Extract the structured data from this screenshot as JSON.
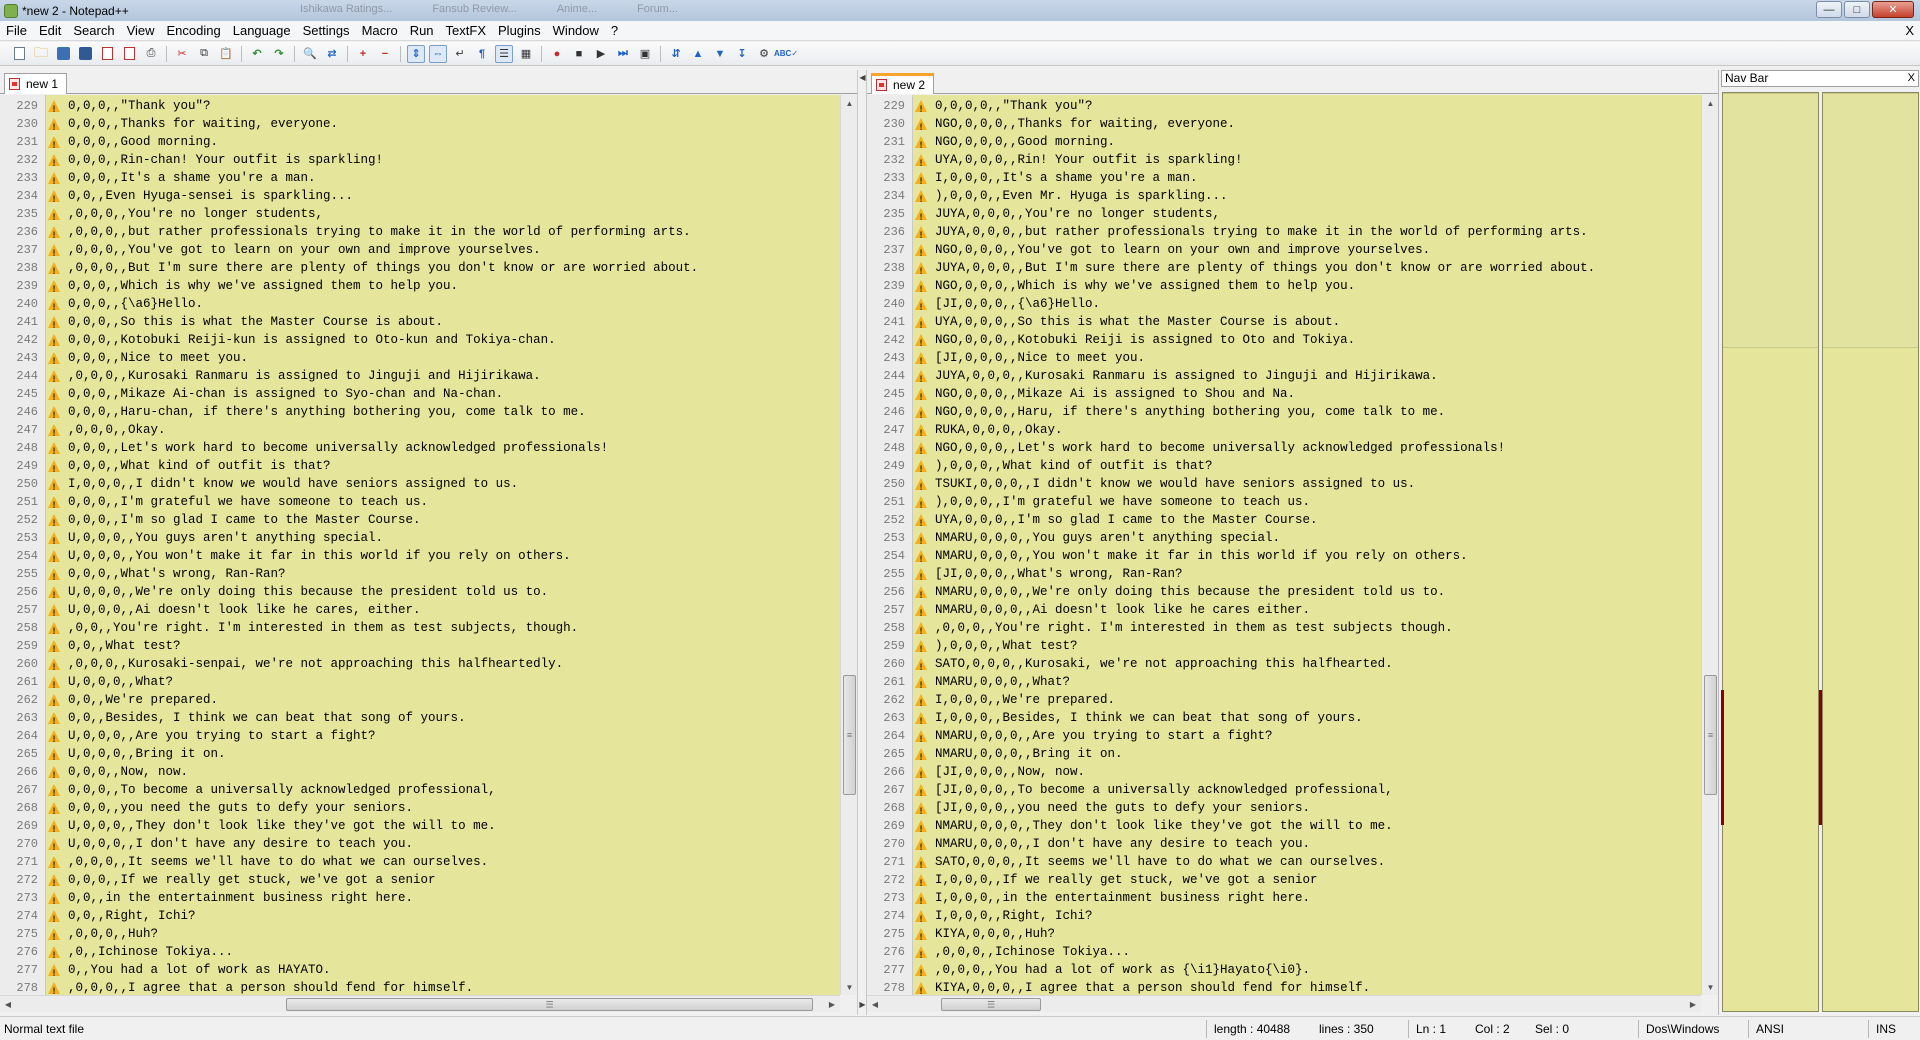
{
  "window": {
    "title": "*new  2 - Notepad++",
    "background_tabs": [
      "Ishikawa Ratings...",
      "Fansub Review...",
      "Anime...",
      "Forum..."
    ]
  },
  "menu": [
    "File",
    "Edit",
    "Search",
    "View",
    "Encoding",
    "Language",
    "Settings",
    "Macro",
    "Run",
    "TextFX",
    "Plugins",
    "Window",
    "?"
  ],
  "menu_close": "X",
  "tabs": {
    "left": "new  1",
    "right": "new  2"
  },
  "nav_bar": {
    "title": "Nav Bar",
    "close": "X"
  },
  "colors": {
    "editor_bg": "#e5e59b",
    "highlight": "#d2d28a",
    "warning": "#f2b01e",
    "tab_accent": "#f7a530",
    "nav_diff": "#8b0000"
  },
  "left_lines": [
    {
      "n": "229",
      "t": "0,0,0,,\"Thank you\"?"
    },
    {
      "n": "230",
      "t": "0,0,0,,Thanks for waiting, everyone."
    },
    {
      "n": "231",
      "t": "0,0,0,,Good morning."
    },
    {
      "n": "232",
      "t": "0,0,0,,Rin-chan! Your outfit is sparkling!"
    },
    {
      "n": "233",
      "t": "0,0,0,,It's a shame you're a man."
    },
    {
      "n": "234",
      "t": "0,0,,Even Hyuga-sensei is sparkling..."
    },
    {
      "n": "235",
      "t": ",0,0,0,,You're no longer students,"
    },
    {
      "n": "236",
      "t": ",0,0,0,,but rather professionals trying to make it in the world of performing arts."
    },
    {
      "n": "237",
      "t": ",0,0,0,,You've got to learn on your own and improve yourselves."
    },
    {
      "n": "238",
      "t": ",0,0,0,,But I'm sure there are plenty of things you don't know or are worried about."
    },
    {
      "n": "239",
      "t": "0,0,0,,Which is why we've assigned them to help you."
    },
    {
      "n": "240",
      "t": "0,0,0,,{\\a6}Hello."
    },
    {
      "n": "241",
      "t": "0,0,0,,So this is what the Master Course is about."
    },
    {
      "n": "242",
      "t": "0,0,0,,Kotobuki Reiji-kun is assigned to Oto-kun and Tokiya-chan."
    },
    {
      "n": "243",
      "t": "0,0,0,,Nice to meet you."
    },
    {
      "n": "244",
      "t": ",0,0,0,,Kurosaki Ranmaru is assigned to Jinguji and Hijirikawa."
    },
    {
      "n": "245",
      "t": "0,0,0,,Mikaze Ai-chan is assigned to Syo-chan and Na-chan."
    },
    {
      "n": "246",
      "t": "0,0,0,,Haru-chan, if there's anything bothering you, come talk to me."
    },
    {
      "n": "247",
      "t": ",0,0,0,,Okay."
    },
    {
      "n": "248",
      "t": "0,0,0,,Let's work hard to become universally acknowledged professionals!"
    },
    {
      "n": "249",
      "t": "0,0,0,,What kind of outfit is that?"
    },
    {
      "n": "250",
      "t": "I,0,0,0,,I didn't know we would have seniors assigned to us."
    },
    {
      "n": "251",
      "t": "0,0,0,,I'm grateful we have someone to teach us."
    },
    {
      "n": "252",
      "t": "0,0,0,,I'm so glad I came to the Master Course."
    },
    {
      "n": "253",
      "t": "U,0,0,0,,You guys aren't anything special."
    },
    {
      "n": "254",
      "t": "U,0,0,0,,You won't make it far in this world if you rely on others."
    },
    {
      "n": "255",
      "t": "0,0,0,,What's wrong, Ran-Ran?"
    },
    {
      "n": "256",
      "t": "U,0,0,0,,We're only doing this because the president told us to."
    },
    {
      "n": "257",
      "t": "U,0,0,0,,Ai doesn't look like he cares, either."
    },
    {
      "n": "258",
      "t": ",0,0,,You're right. I'm interested in them as test subjects, though."
    },
    {
      "n": "259",
      "t": "0,0,,What test?"
    },
    {
      "n": "260",
      "t": ",0,0,0,,Kurosaki-senpai, we're not approaching this halfheartedly."
    },
    {
      "n": "261",
      "t": "U,0,0,0,,What?"
    },
    {
      "n": "262",
      "t": "0,0,,We're prepared."
    },
    {
      "n": "263",
      "t": "0,0,,Besides, I think we can beat that song of yours."
    },
    {
      "n": "264",
      "t": "U,0,0,0,,Are you trying to start a fight?"
    },
    {
      "n": "265",
      "t": "U,0,0,0,,Bring it on."
    },
    {
      "n": "266",
      "t": "0,0,0,,Now, now."
    },
    {
      "n": "267",
      "t": "0,0,0,,To become a universally acknowledged professional,"
    },
    {
      "n": "268",
      "t": "0,0,0,,you need the guts to defy your seniors."
    },
    {
      "n": "269",
      "t": "U,0,0,0,,They don't look like they've got the will to me."
    },
    {
      "n": "270",
      "t": "U,0,0,0,,I don't have any desire to teach you."
    },
    {
      "n": "271",
      "t": ",0,0,0,,It seems we'll have to do what we can ourselves."
    },
    {
      "n": "272",
      "t": "0,0,0,,If we really get stuck, we've got a senior"
    },
    {
      "n": "273",
      "t": "0,0,,in the entertainment business right here."
    },
    {
      "n": "274",
      "t": "0,0,,Right, Ichi?"
    },
    {
      "n": "275",
      "t": ",0,0,0,,Huh?"
    },
    {
      "n": "276",
      "t": ",0,,Ichinose Tokiya..."
    },
    {
      "n": "277",
      "t": "0,,You had a lot of work as HAYATO."
    },
    {
      "n": "278",
      "t": ",0,0,0,,I agree that a person should fend for himself."
    }
  ],
  "right_lines": [
    {
      "n": "229",
      "t": "0,0,0,0,,\"Thank you\"?"
    },
    {
      "n": "230",
      "t": "NGO,0,0,0,,Thanks for waiting, everyone."
    },
    {
      "n": "231",
      "t": "NGO,0,0,0,,Good morning."
    },
    {
      "n": "232",
      "t": "UYA,0,0,0,,Rin! Your outfit is sparkling!"
    },
    {
      "n": "233",
      "t": "I,0,0,0,,It's a shame you're a man."
    },
    {
      "n": "234",
      "t": "),0,0,0,,Even Mr. Hyuga is sparkling..."
    },
    {
      "n": "235",
      "t": "JUYA,0,0,0,,You're no longer students,"
    },
    {
      "n": "236",
      "t": "JUYA,0,0,0,,but rather professionals trying to make it in the world of performing arts."
    },
    {
      "n": "237",
      "t": "NGO,0,0,0,,You've got to learn on your own and improve yourselves."
    },
    {
      "n": "238",
      "t": "JUYA,0,0,0,,But I'm sure there are plenty of things you don't know or are worried about."
    },
    {
      "n": "239",
      "t": "NGO,0,0,0,,Which is why we've assigned them to help you."
    },
    {
      "n": "240",
      "t": "[JI,0,0,0,,{\\a6}Hello."
    },
    {
      "n": "241",
      "t": "UYA,0,0,0,,So this is what the Master Course is about."
    },
    {
      "n": "242",
      "t": "NGO,0,0,0,,Kotobuki Reiji is assigned to Oto and Tokiya."
    },
    {
      "n": "243",
      "t": "[JI,0,0,0,,Nice to meet you."
    },
    {
      "n": "244",
      "t": "JUYA,0,0,0,,Kurosaki Ranmaru is assigned to Jinguji and Hijirikawa."
    },
    {
      "n": "245",
      "t": "NGO,0,0,0,,Mikaze Ai is assigned to Shou and Na."
    },
    {
      "n": "246",
      "t": "NGO,0,0,0,,Haru, if there's anything bothering you, come talk to me."
    },
    {
      "n": "247",
      "t": "RUKA,0,0,0,,Okay."
    },
    {
      "n": "248",
      "t": "NGO,0,0,0,,Let's work hard to become universally acknowledged professionals!"
    },
    {
      "n": "249",
      "t": "),0,0,0,,What kind of outfit is that?"
    },
    {
      "n": "250",
      "t": "TSUKI,0,0,0,,I didn't know we would have seniors assigned to us."
    },
    {
      "n": "251",
      "t": "),0,0,0,,I'm grateful we have someone to teach us."
    },
    {
      "n": "252",
      "t": "UYA,0,0,0,,I'm so glad I came to the Master Course."
    },
    {
      "n": "253",
      "t": "NMARU,0,0,0,,You guys aren't anything special."
    },
    {
      "n": "254",
      "t": "NMARU,0,0,0,,You won't make it far in this world if you rely on others."
    },
    {
      "n": "255",
      "t": "[JI,0,0,0,,What's wrong, Ran-Ran?"
    },
    {
      "n": "256",
      "t": "NMARU,0,0,0,,We're only doing this because the president told us to."
    },
    {
      "n": "257",
      "t": "NMARU,0,0,0,,Ai doesn't look like he cares either."
    },
    {
      "n": "258",
      "t": ",0,0,0,,You're right. I'm interested in them as test subjects though."
    },
    {
      "n": "259",
      "t": "),0,0,0,,What test?"
    },
    {
      "n": "260",
      "t": "SATO,0,0,0,,Kurosaki, we're not approaching this halfhearted."
    },
    {
      "n": "261",
      "t": "NMARU,0,0,0,,What?"
    },
    {
      "n": "262",
      "t": "I,0,0,0,,We're prepared."
    },
    {
      "n": "263",
      "t": "I,0,0,0,,Besides, I think we can beat that song of yours."
    },
    {
      "n": "264",
      "t": "NMARU,0,0,0,,Are you trying to start a fight?"
    },
    {
      "n": "265",
      "t": "NMARU,0,0,0,,Bring it on."
    },
    {
      "n": "266",
      "t": "[JI,0,0,0,,Now, now."
    },
    {
      "n": "267",
      "t": "[JI,0,0,0,,To become a universally acknowledged professional,"
    },
    {
      "n": "268",
      "t": "[JI,0,0,0,,you need the guts to defy your seniors."
    },
    {
      "n": "269",
      "t": "NMARU,0,0,0,,They don't look like they've got the will to me."
    },
    {
      "n": "270",
      "t": "NMARU,0,0,0,,I don't have any desire to teach you."
    },
    {
      "n": "271",
      "t": "SATO,0,0,0,,It seems we'll have to do what we can ourselves."
    },
    {
      "n": "272",
      "t": "I,0,0,0,,If we really get stuck, we've got a senior"
    },
    {
      "n": "273",
      "t": "I,0,0,0,,in the entertainment business right here."
    },
    {
      "n": "274",
      "t": "I,0,0,0,,Right, Ichi?"
    },
    {
      "n": "275",
      "t": "KIYA,0,0,0,,Huh?"
    },
    {
      "n": "276",
      "t": ",0,0,0,,Ichinose Tokiya..."
    },
    {
      "n": "277",
      "t": ",0,0,0,,You had a lot of work as {\\i1}Hayato{\\i0}."
    },
    {
      "n": "278",
      "t": "KIYA,0,0,0,,I agree that a person should fend for himself."
    }
  ],
  "status": {
    "file_type": "Normal text file",
    "length": "length : 40488",
    "lines": "lines : 350",
    "ln": "Ln : 1",
    "col": "Col : 2",
    "sel": "Sel : 0",
    "eol": "Dos\\Windows",
    "encoding": "ANSI",
    "mode": "INS"
  }
}
